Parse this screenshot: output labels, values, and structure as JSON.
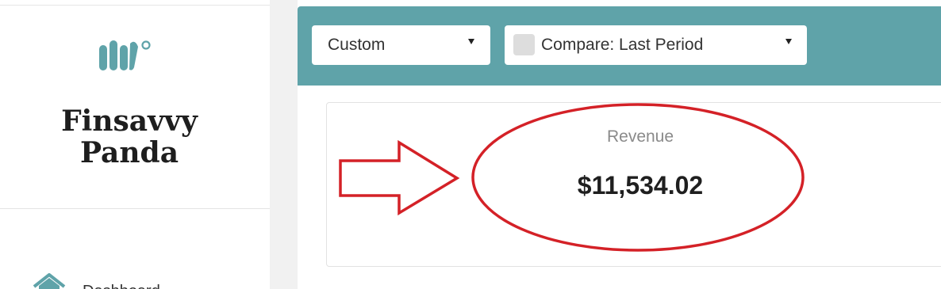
{
  "sidebar": {
    "brand_name": "Finsavvy\nPanda",
    "nav_items": [
      {
        "label": "Dashboard",
        "icon": "house-icon"
      }
    ]
  },
  "toolbar": {
    "date_range": {
      "selected": "Custom"
    },
    "compare": {
      "label": "Compare: Last Period",
      "checked": false
    }
  },
  "metric_card": {
    "label": "Revenue",
    "value": "$11,534.02"
  },
  "colors": {
    "toolbar_bg": "#5fa3a9",
    "brand_teal": "#5fa3a9",
    "annotation_red": "#d42127"
  },
  "icons": [
    "logo-mark-icon",
    "house-icon",
    "chevron-down-icon",
    "arrow-right-icon"
  ]
}
